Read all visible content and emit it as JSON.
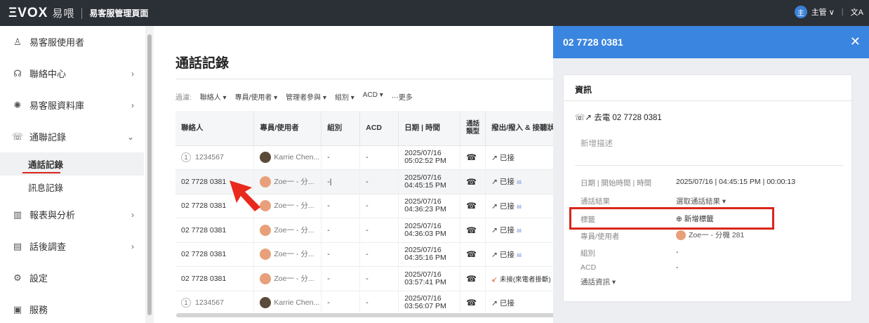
{
  "topbar": {
    "logo_text": "ΞVOX",
    "logo_cn": "易喂",
    "app_title": "易客服管理頁面",
    "user_initial": "主",
    "user_label": "主管 ∨",
    "lang_icon": "文A"
  },
  "sidebar": {
    "items": [
      {
        "label": "易客服使用者",
        "icon": "user-icon"
      },
      {
        "label": "聯絡中心",
        "icon": "headset-icon"
      },
      {
        "label": "易客服資料庫",
        "icon": "bulb-icon"
      },
      {
        "label": "通聯記錄",
        "icon": "call-log-icon"
      },
      {
        "label": "報表與分析",
        "icon": "chart-icon"
      },
      {
        "label": "話後調查",
        "icon": "survey-icon"
      },
      {
        "label": "設定",
        "icon": "gear-icon"
      },
      {
        "label": "服務",
        "icon": "service-icon"
      }
    ],
    "sub_items": [
      "通話記錄",
      "訊息記錄"
    ]
  },
  "main": {
    "title": "通話記錄",
    "filter_label": "過濾:",
    "filters": [
      "聯絡人 ▾",
      "專員/使用者 ▾",
      "管理者參與 ▾",
      "組別 ▾",
      "ACD ▾",
      "⋯更多"
    ]
  },
  "table": {
    "headers": [
      "聯絡人",
      "專員/使用者",
      "組別",
      "ACD",
      "日期 | 時間",
      "通話類型",
      "撥出/撥入 & 接聽狀況"
    ],
    "rows": [
      {
        "contact": "1234567",
        "badge": "1",
        "agent": "Karrie Chen...",
        "group": "-",
        "acd": "-",
        "date": "2025/07/16",
        "time": "05:02:52 PM",
        "status": "已接",
        "wave": ""
      },
      {
        "contact": "02 7728 0381",
        "badge": "",
        "agent": "Zoe一 - 分...",
        "group": "-|",
        "acd": "-",
        "date": "2025/07/16",
        "time": "04:45:15 PM",
        "status": "已接",
        "wave": "ılıılı"
      },
      {
        "contact": "02 7728 0381",
        "badge": "",
        "agent": "Zoe一 - 分...",
        "group": "-",
        "acd": "-",
        "date": "2025/07/16",
        "time": "04:36:23 PM",
        "status": "已接",
        "wave": "ılıılı"
      },
      {
        "contact": "02 7728 0381",
        "badge": "",
        "agent": "Zoe一 - 分...",
        "group": "-",
        "acd": "-",
        "date": "2025/07/16",
        "time": "04:36:03 PM",
        "status": "已接",
        "wave": "ılıılı"
      },
      {
        "contact": "02 7728 0381",
        "badge": "",
        "agent": "Zoe一 - 分...",
        "group": "-",
        "acd": "-",
        "date": "2025/07/16",
        "time": "04:35:16 PM",
        "status": "已接",
        "wave": "ılıılı"
      },
      {
        "contact": "02 7728 0381",
        "badge": "",
        "agent": "Zoe一 - 分...",
        "group": "-",
        "acd": "-",
        "date": "2025/07/16",
        "time": "03:57:41 PM",
        "status": "未接(來電者掛斷)",
        "wave": ""
      },
      {
        "contact": "1234567",
        "badge": "1",
        "agent": "Karrie Chen...",
        "group": "-",
        "acd": "-",
        "date": "2025/07/16",
        "time": "03:56:07 PM",
        "status": "已接",
        "wave": ""
      }
    ]
  },
  "panel": {
    "title": "02 7728 0381",
    "close": "✕",
    "section": "資訊",
    "call_label": "去電 02 7728 0381",
    "desc_placeholder": "新增描述",
    "fields": {
      "datetime_label": "日期 | 開始時間 | 時間",
      "datetime_value": "2025/07/16 | 04:45:15 PM | 00:00:13",
      "result_label": "通話結果",
      "result_value": "選取通話結果 ▾",
      "tag_label": "標籤",
      "tag_value": "新增標籤",
      "agent_label": "專員/使用者",
      "agent_value": "Zoe一 - 分機 281",
      "group_label": "組別",
      "group_value": "-",
      "acd_label": "ACD",
      "acd_value": "-",
      "callinfo_label": "通話資訊 ▾"
    }
  },
  "colors": {
    "accent": "#3a85df",
    "highlight_red": "#d9261c",
    "topbar": "#2b2f36"
  }
}
